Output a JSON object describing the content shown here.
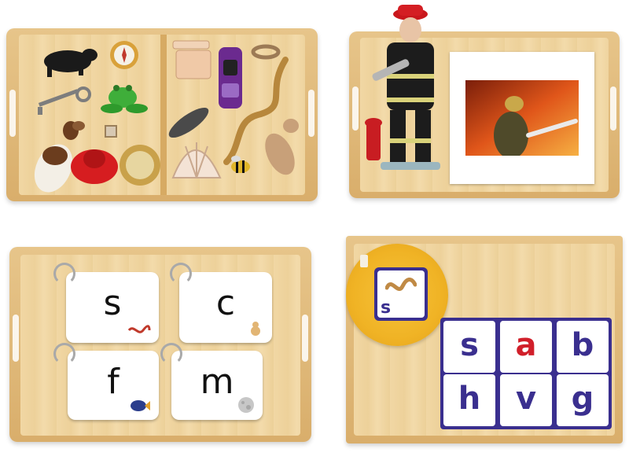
{
  "phonics_cards": {
    "card1": "s",
    "card2": "c",
    "card3": "f",
    "card4": "m"
  },
  "basket_card": {
    "letter": "s"
  },
  "letter_tiles": {
    "row1": [
      "s",
      "a",
      "b"
    ],
    "row2": [
      "h",
      "v",
      "g"
    ]
  },
  "colors": {
    "tile_border": "#3a2f8f",
    "consonant": "#3a2f8f",
    "vowel": "#d11f2a",
    "basket": "#f1b92f",
    "wood": "#e3be7f"
  }
}
